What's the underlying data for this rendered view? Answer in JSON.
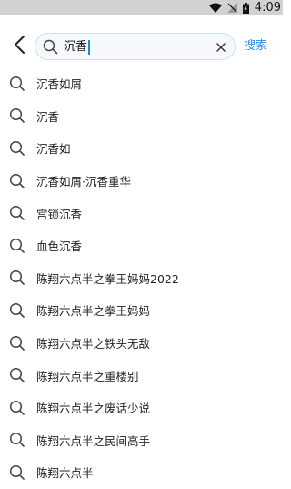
{
  "status_bar": {
    "time": "4:09"
  },
  "search": {
    "query": "沉香",
    "submit_label": "搜索"
  },
  "suggestions": [
    "沉香如屑",
    "沉香",
    "沉香如",
    "沉香如屑·沉香重华",
    "宫锁沉香",
    "血色沉香",
    "陈翔六点半之拳王妈妈2022",
    "陈翔六点半之拳王妈妈",
    "陈翔六点半之铁头无敌",
    "陈翔六点半之重楼别",
    "陈翔六点半之废话少说",
    "陈翔六点半之民间高手",
    "陈翔六点半"
  ],
  "colors": {
    "accent": "#2a8be6",
    "search_border": "#c7e2f0",
    "search_bg": "#f5f9fb",
    "status_bar_bg": "#d2d2d2"
  },
  "icons": {
    "back": "chevron-left-icon",
    "search": "search-icon",
    "clear": "close-icon",
    "suggestion": "search-icon"
  }
}
